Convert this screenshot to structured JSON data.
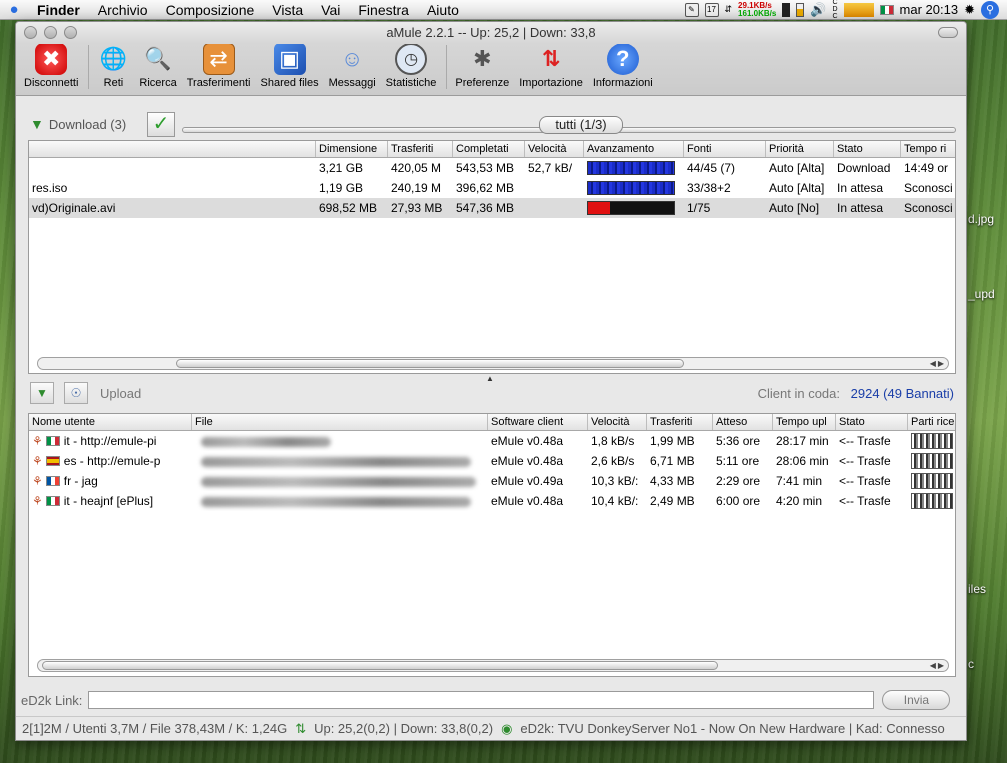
{
  "menubar": {
    "apple": "",
    "items": [
      "Finder",
      "Archivio",
      "Composizione",
      "Vista",
      "Vai",
      "Finestra",
      "Aiuto"
    ],
    "calendar_day": "17",
    "net_up": "29.1KB/s",
    "net_down": "161.0KB/s",
    "clock": "mar 20:13"
  },
  "desktop": {
    "labels": [
      "d.jpg",
      "_upd",
      "iles",
      "c"
    ]
  },
  "window": {
    "title": "aMule 2.2.1 -- Up: 25,2 | Down: 33,8"
  },
  "toolbar": {
    "buttons": [
      {
        "label": "Disconnetti",
        "icon": "disconnect-icon"
      },
      {
        "label": "Reti",
        "icon": "network-globe-icon"
      },
      {
        "label": "Ricerca",
        "icon": "search-magnifier-icon"
      },
      {
        "label": "Trasferimenti",
        "icon": "transfers-icon"
      },
      {
        "label": "Shared files",
        "icon": "shared-files-icon"
      },
      {
        "label": "Messaggi",
        "icon": "messages-user-icon"
      },
      {
        "label": "Statistiche",
        "icon": "statistics-gauge-icon"
      },
      {
        "label": "Preferenze",
        "icon": "preferences-tools-icon"
      },
      {
        "label": "Importazione",
        "icon": "import-arrows-icon"
      },
      {
        "label": "Informazioni",
        "icon": "info-question-icon"
      }
    ]
  },
  "download": {
    "label": "Download (3)",
    "filter": "tutti (1/3)",
    "columns": [
      "",
      "Dimensione",
      "Trasferiti",
      "Completati",
      "Velocità",
      "Avanzamento",
      "Fonti",
      "Priorità",
      "Stato",
      "Tempo ri"
    ],
    "rows": [
      {
        "name": "",
        "size": "3,21 GB",
        "transferred": "420,05 M",
        "completed": "543,53 MB",
        "speed": "52,7 kB/",
        "progress": 1.0,
        "progress_color": "#1a2cc8",
        "sources": "44/45 (7)",
        "priority": "Auto [Alta]",
        "status": "Download",
        "time": "14:49 or"
      },
      {
        "name": "res.iso",
        "size": "1,19 GB",
        "transferred": "240,19 M",
        "completed": "396,62 MB",
        "speed": "",
        "progress": 1.0,
        "progress_color": "#1a2cc8",
        "sources": "33/38+2",
        "priority": "Auto [Alta]",
        "status": "In attesa",
        "time": "Sconosci"
      },
      {
        "name": "vd)Originale.avi",
        "size": "698,52 MB",
        "transferred": "27,93 MB",
        "completed": "547,36 MB",
        "speed": "",
        "progress": 0.25,
        "progress_color": "#e01010",
        "sources": "1/75",
        "priority": "Auto [No]",
        "status": "In attesa",
        "time": "Sconosci"
      }
    ]
  },
  "upload": {
    "label": "Upload",
    "queue_label": "Client in coda:",
    "queue_value": "2924 (49 Bannati)",
    "columns": [
      "Nome utente",
      "File",
      "Software client",
      "Velocità",
      "Trasferiti",
      "Atteso",
      "Tempo upl",
      "Stato",
      "Parti rice"
    ],
    "rows": [
      {
        "flag": "it",
        "user": "it - http://emule-pi",
        "software": "eMule v0.48a",
        "speed": "1,8 kB/s",
        "transferred": "1,99 MB",
        "waited": "5:36 ore",
        "upload_time": "28:17 min",
        "status": "<-- Trasfe"
      },
      {
        "flag": "es",
        "user": "es - http://emule-p",
        "software": "eMule v0.48a",
        "speed": "2,6 kB/s",
        "transferred": "6,71 MB",
        "waited": "5:11 ore",
        "upload_time": "28:06 min",
        "status": "<-- Trasfe"
      },
      {
        "flag": "fr",
        "user": "fr - jag",
        "software": "eMule v0.49a",
        "speed": "10,3 kB/:",
        "transferred": "4,33 MB",
        "waited": "2:29 ore",
        "upload_time": "7:41 min",
        "status": "<-- Trasfe"
      },
      {
        "flag": "it",
        "user": "it - heajnf [ePlus]",
        "software": "eMule v0.48a",
        "speed": "10,4 kB/:",
        "transferred": "2,49 MB",
        "waited": "6:00 ore",
        "upload_time": "4:20 min",
        "status": "<-- Trasfe"
      }
    ]
  },
  "ed2k": {
    "label": "eD2k Link:",
    "value": "",
    "send": "Invia"
  },
  "statusbar": {
    "left": "2[1]2M / Utenti 3,7M / File 378,43M / K: 1,24G",
    "transfer": "Up: 25,2(0,2) | Down: 33,8(0,2)",
    "server": "eD2k: TVU DonkeyServer No1 - Now On New Hardware | Kad: Connesso"
  }
}
